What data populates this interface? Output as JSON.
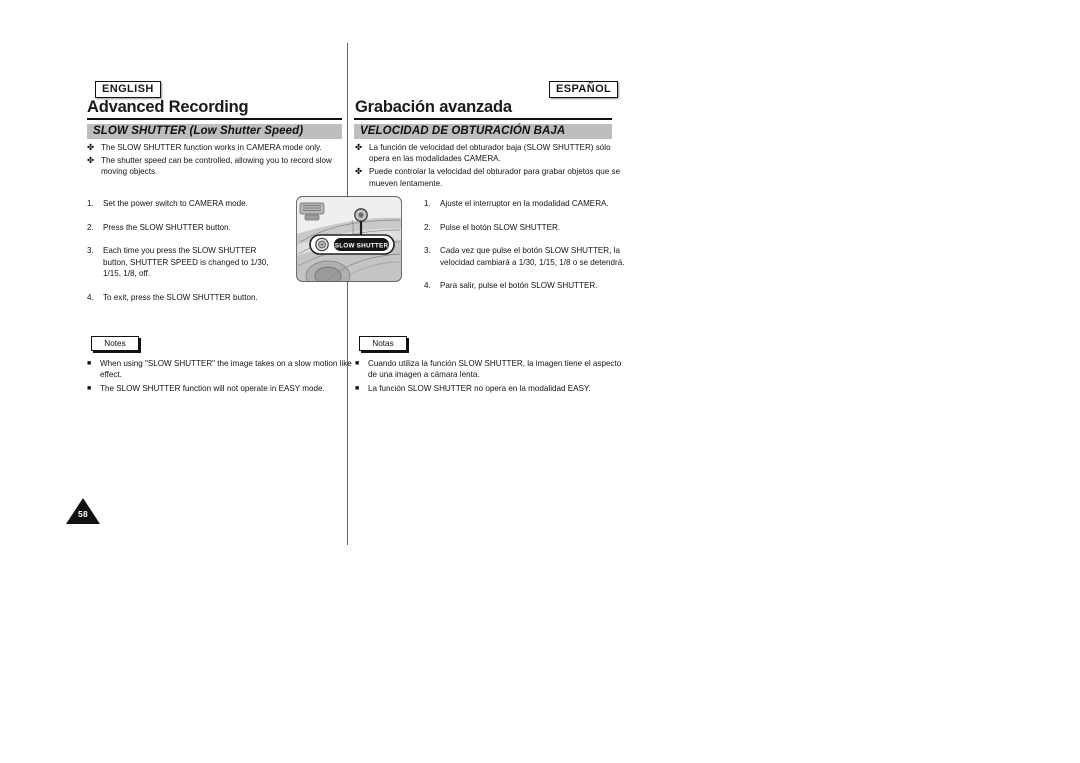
{
  "document": {
    "page_number": "58"
  },
  "left": {
    "language_badge": "ENGLISH",
    "chapter_title": "Advanced Recording",
    "section_title": "SLOW SHUTTER (Low Shutter Speed)",
    "intro_bullets": [
      "The SLOW SHUTTER function works in CAMERA mode only.",
      "The shutter speed can be controlled, allowing you to record slow moving objects."
    ],
    "steps": [
      {
        "num": "1.",
        "text": "Set the power switch to CAMERA mode."
      },
      {
        "num": "2.",
        "text": "Press the SLOW SHUTTER button."
      },
      {
        "num": "3.",
        "text": "Each time you press the SLOW SHUTTER button, SHUTTER SPEED is changed to 1/30, 1/15, 1/8, off."
      },
      {
        "num": "4.",
        "text": "To exit, press the SLOW SHUTTER button."
      }
    ],
    "notes_label": "Notes",
    "notes": [
      "When using \"SLOW SHUTTER\" the image takes on a slow motion like effect.",
      "The SLOW SHUTTER function will not operate in EASY mode."
    ]
  },
  "right": {
    "language_badge": "ESPAÑOL",
    "chapter_title": "Grabación avanzada",
    "section_title": "VELOCIDAD DE OBTURACIÓN BAJA",
    "intro_bullets": [
      "La función de velocidad del obturador baja (SLOW SHUTTER) sólo opera en las modalidades CAMERA.",
      "Puede controlar la velocidad del obturador para grabar objetos que se mueven lentamente."
    ],
    "steps": [
      {
        "num": "1.",
        "text": "Ajuste el interruptor en la modalidad CAMERA."
      },
      {
        "num": "2.",
        "text": "Pulse el botón SLOW SHUTTER."
      },
      {
        "num": "3.",
        "text": "Cada vez que pulse el botón SLOW SHUTTER, la velocidad cambiará a 1/30, 1/15, 1/8 o se detendrá."
      },
      {
        "num": "4.",
        "text": "Para salir, pulse el botón SLOW SHUTTER."
      }
    ],
    "notes_label": "Notas",
    "notes": [
      "Cuando utiliza la función SLOW SHUTTER, la imagen tiene el aspecto de una imagen a cámara lenta.",
      "La función SLOW SHUTTER no opera en la modalidad EASY."
    ]
  },
  "figure": {
    "caption_button_label": "SLOW SHUTTER",
    "alt": "camcorder body with SLOW SHUTTER button callout"
  },
  "glyphs": {
    "diamond_bullet": "✤",
    "square_bullet": "■"
  },
  "colors": {
    "section_bar": "#bdbdbd",
    "rule": "#111111",
    "text": "#141414"
  }
}
